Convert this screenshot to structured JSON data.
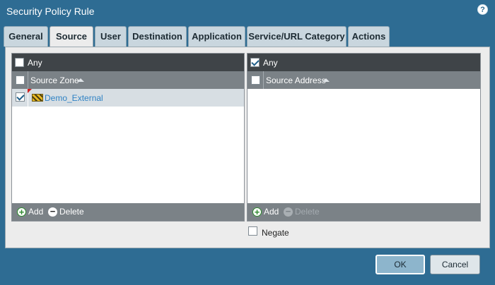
{
  "dialog": {
    "title": "Security Policy Rule",
    "help_icon": "?"
  },
  "tabs": [
    {
      "label": "General",
      "active": false
    },
    {
      "label": "Source",
      "active": true
    },
    {
      "label": "User",
      "active": false
    },
    {
      "label": "Destination",
      "active": false
    },
    {
      "label": "Application",
      "active": false
    },
    {
      "label": "Service/URL Category",
      "active": false
    },
    {
      "label": "Actions",
      "active": false
    }
  ],
  "source_zone": {
    "any_label": "Any",
    "any_checked": false,
    "column_header": "Source Zone",
    "rows": [
      {
        "name": "Demo_External",
        "checked": true,
        "icon": "zone-icon"
      }
    ],
    "add_label": "Add",
    "delete_label": "Delete"
  },
  "source_address": {
    "any_label": "Any",
    "any_checked": true,
    "column_header": "Source Address",
    "rows": [],
    "add_label": "Add",
    "delete_label": "Delete",
    "delete_disabled": true
  },
  "negate": {
    "label": "Negate",
    "checked": false
  },
  "buttons": {
    "ok": "OK",
    "cancel": "Cancel"
  },
  "colors": {
    "background": "#2e6c93",
    "link": "#2f82c4",
    "header_dark": "#3f4448",
    "header_gray": "#7b8287"
  }
}
